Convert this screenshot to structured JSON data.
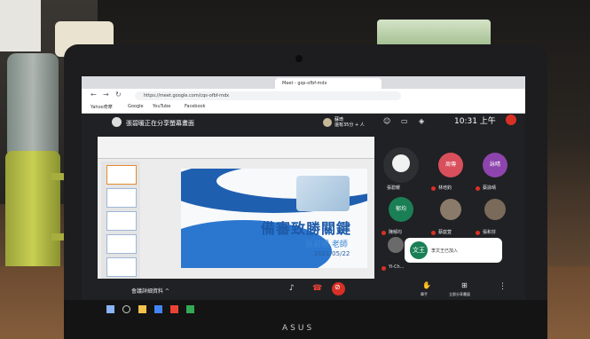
{
  "browser": {
    "tab_title": "Meet - gqs-ofbf-mdx",
    "url": "https://meet.google.com/cqs-ofbf-mdx",
    "bookmarks": [
      "Yahoo奇摩",
      "Google",
      "YouTube",
      "Facebook"
    ]
  },
  "meet": {
    "presenter_text": "張碧暖正在分享螢幕畫面",
    "viewer_name": "蘇琦",
    "viewer_sub": "還有35分 + 人",
    "time": "10:31 上午",
    "details_label": "會議詳細資料 ^",
    "present_label": "舉手",
    "present_now_label": "立即分享畫面"
  },
  "slide": {
    "title": "備審致勝關鍵",
    "subtitle": "張碧暖 老師",
    "date": "2021/05/22"
  },
  "participants": [
    {
      "name": "張碧暖",
      "avatar": "photo",
      "color": "#ffffff"
    },
    {
      "name": "林培鈞",
      "avatar": "周傳",
      "color": "#d94f5c"
    },
    {
      "name": "蔡詠晴",
      "avatar": "詠晴",
      "color": "#8e44ad"
    },
    {
      "name": "陳郁均",
      "avatar": "郁均",
      "color": "#1a7f55"
    },
    {
      "name": "蔡庭萱",
      "avatar": "photo",
      "color": "#8a7a6a"
    },
    {
      "name": "張和芬",
      "avatar": "photo",
      "color": "#7a6a5a"
    },
    {
      "name": "Yi-Ch...",
      "avatar": "photo",
      "color": "#6a6a6a"
    }
  ],
  "notice": {
    "avatar": "文王",
    "text": "李文王已加入"
  },
  "colors": {
    "meet_bg": "#202124",
    "end_call": "#d93025",
    "slide_blue": "#1d5aa8"
  },
  "brand": "ASUS"
}
